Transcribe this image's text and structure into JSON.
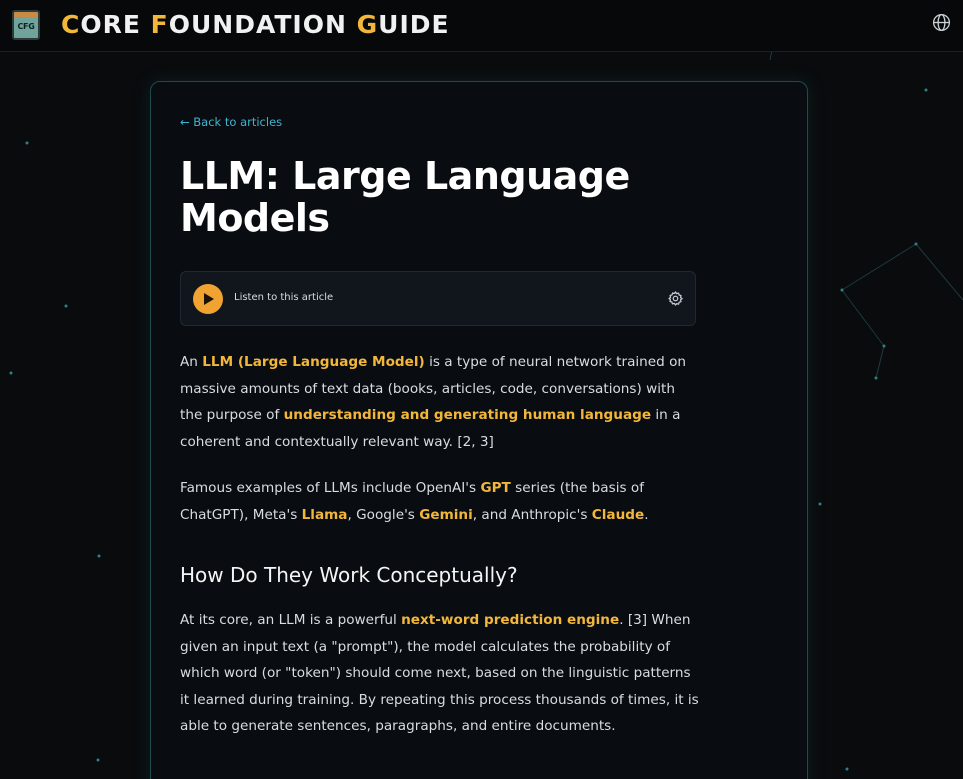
{
  "header": {
    "logo_text": "CFG",
    "brand_parts": [
      {
        "text": "C",
        "accent": true
      },
      {
        "text": "ORE ",
        "accent": false
      },
      {
        "text": "F",
        "accent": true
      },
      {
        "text": "OUNDATION ",
        "accent": false
      },
      {
        "text": "G",
        "accent": true
      },
      {
        "text": "UIDE",
        "accent": false
      }
    ],
    "language_icon": "globe-icon"
  },
  "article": {
    "back_link": "← Back to articles",
    "title": "LLM: Large Language Models",
    "player": {
      "label": "Listen to this article",
      "play_icon": "play-icon",
      "settings_icon": "gear-icon"
    },
    "p1": {
      "t1": "An ",
      "h1": "LLM (Large Language Model)",
      "t2": " is a type of neural network trained on massive amounts of text data (books, articles, code, conversations) with the purpose of ",
      "h2": "understanding and generating human language",
      "t3": " in a coherent and contextually relevant way. [2, 3]"
    },
    "p2": {
      "t1": "Famous examples of LLMs include OpenAI's ",
      "h1": "GPT",
      "t2": " series (the basis of ChatGPT), Meta's ",
      "h2": "Llama",
      "t3": ", Google's ",
      "h3": "Gemini",
      "t4": ", and Anthropic's ",
      "h4": "Claude",
      "t5": "."
    },
    "section_heading": "How Do They Work Conceptually?",
    "p3": {
      "t1": "At its core, an LLM is a powerful ",
      "h1": "next-word prediction engine",
      "t2": ". [3] When given an input text (a \"prompt\"), the model calculates the probability of which word (or \"token\") should come next, based on the linguistic patterns it learned during training. By repeating this process thousands of times, it is able to generate sentences, paragraphs, and entire documents."
    }
  },
  "colors": {
    "accent": "#f2b73a",
    "link": "#3fb6d1",
    "play_button": "#f0a330",
    "background": "#0a0b0d"
  }
}
